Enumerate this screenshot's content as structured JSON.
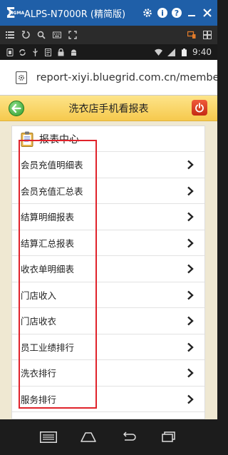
{
  "emulator": {
    "logo_text": "Σ",
    "brand": "SIGMA",
    "title": "ALPS-N7000R (精简版)"
  },
  "status": {
    "time": "9:40"
  },
  "browser": {
    "url": "report-xiyi.bluegrid.com.cn/members"
  },
  "page": {
    "title": "洗衣店手机看报表"
  },
  "panel": {
    "title": "报表中心",
    "items": [
      {
        "label": "会员充值明细表"
      },
      {
        "label": "会员充值汇总表"
      },
      {
        "label": "结算明细报表"
      },
      {
        "label": "结算汇总报表"
      },
      {
        "label": "收衣单明细表"
      },
      {
        "label": "门店收入"
      },
      {
        "label": "门店收衣"
      },
      {
        "label": "员工业绩排行"
      },
      {
        "label": "洗衣排行"
      },
      {
        "label": "服务排行"
      }
    ]
  },
  "colors": {
    "emulator_bar": "#1f5fa8",
    "header": "#f6c94d",
    "highlight": "#e0232b"
  }
}
